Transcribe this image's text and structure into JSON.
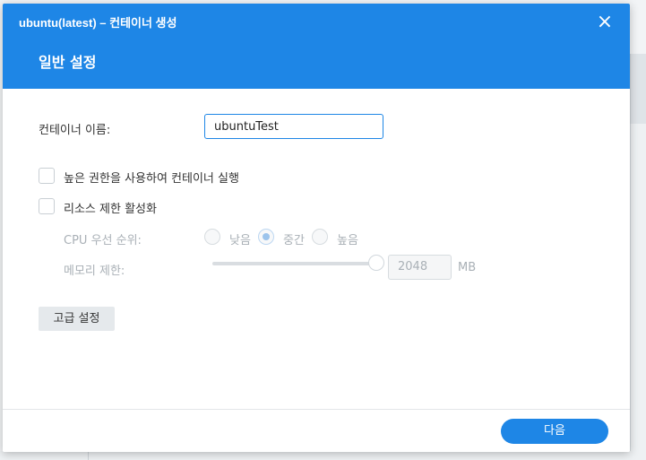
{
  "window": {
    "title": "ubuntu(latest) – 컨테이너 생성",
    "close_icon": "×"
  },
  "section": {
    "title": "일반 설정"
  },
  "form": {
    "container_name_label": "컨테이너 이름:",
    "container_name_value": "ubuntuTest",
    "privileged_label": "높은 권한을 사용하여 컨테이너 실행",
    "privileged_checked": false,
    "resource_limit_label": "리소스 제한 활성화",
    "resource_limit_checked": false,
    "cpu_priority_label": "CPU 우선 순위:",
    "cpu_options": [
      {
        "label": "낮음",
        "checked": false
      },
      {
        "label": "중간",
        "checked": true
      },
      {
        "label": "높음",
        "checked": false
      }
    ],
    "memory_limit_label": "메모리 제한:",
    "memory_value": "2048",
    "memory_unit": "MB",
    "memory_slider_level": 1.0,
    "advanced_button": "고급 설정"
  },
  "footer": {
    "next_button": "다음"
  },
  "colors": {
    "accent": "#1e86e6",
    "disabled_text": "#a9b0b6"
  }
}
